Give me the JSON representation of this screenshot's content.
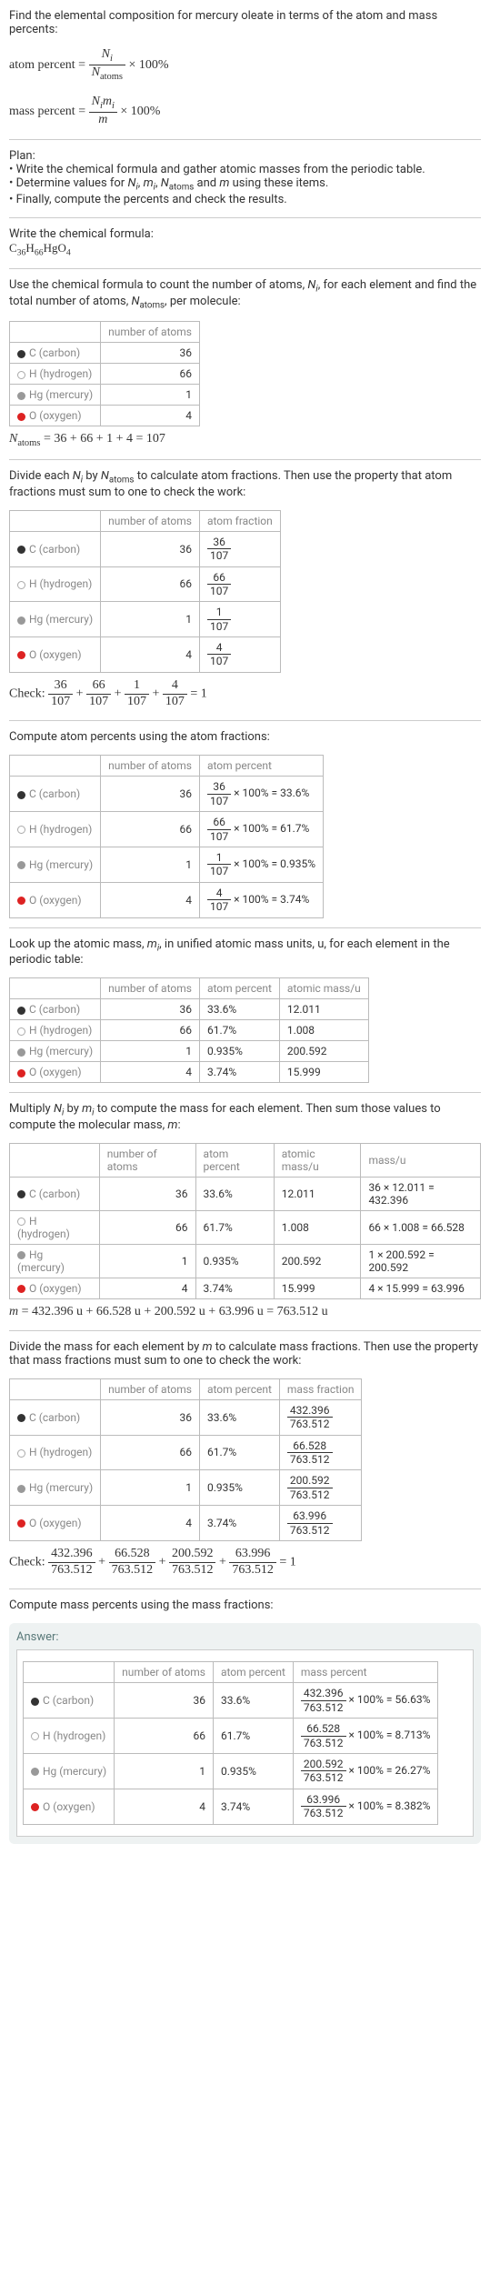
{
  "intro": "Find the elemental composition for mercury oleate in terms of the atom and mass percents:",
  "atom_percent_label": "atom percent = ",
  "atom_percent_frac_num": "N",
  "atom_percent_frac_num_sub": "i",
  "atom_percent_frac_den": "N",
  "atom_percent_frac_den_sub": "atoms",
  "times100": " × 100%",
  "mass_percent_label": "mass percent = ",
  "mass_percent_num": "N",
  "mass_percent_num_sub": "i",
  "mass_percent_num2": "m",
  "mass_percent_num2_sub": "i",
  "mass_percent_den": "m",
  "plan_title": "Plan:",
  "plan1": "• Write the chemical formula and gather atomic masses from the periodic table.",
  "plan2_a": "• Determine values for ",
  "plan2_n": "N",
  "plan2_ni": "i",
  "plan2_b": ", ",
  "plan2_m": "m",
  "plan2_mi": "i",
  "plan2_c": ", ",
  "plan2_na": "N",
  "plan2_nas": "atoms",
  "plan2_d": " and ",
  "plan2_mm": "m",
  "plan2_e": " using these items.",
  "plan3": "• Finally, compute the percents and check the results.",
  "write_formula": "Write the chemical formula:",
  "formula_c": "C",
  "formula_36": "36",
  "formula_h": "H",
  "formula_66": "66",
  "formula_hg": "Hg",
  "formula_o": "O",
  "formula_4": "4",
  "count_text_a": "Use the chemical formula to count the number of atoms, ",
  "count_text_b": ", for each element and find the total number of atoms, ",
  "count_text_c": ", per molecule:",
  "hdr_num_atoms": "number of atoms",
  "el_c": "C (carbon)",
  "el_h": "H (hydrogen)",
  "el_hg": "Hg (mercury)",
  "el_o": "O (oxygen)",
  "n_c": "36",
  "n_h": "66",
  "n_hg": "1",
  "n_o": "4",
  "natoms_eq": " = 36 + 66 + 1 + 4 = 107",
  "divide_text_a": "Divide each ",
  "divide_text_b": " by ",
  "divide_text_c": " to calculate atom fractions. Then use the property that atom fractions must sum to one to check the work:",
  "hdr_atom_frac": "atom fraction",
  "f36": "36",
  "f66": "66",
  "f1": "1",
  "f4": "4",
  "f107": "107",
  "check_label": "Check: ",
  "check_eq": " = 1",
  "compute_atom_pct": "Compute atom percents using the atom fractions:",
  "hdr_atom_pct": "atom percent",
  "ap_c": " × 100% = 33.6%",
  "ap_h": " × 100% = 61.7%",
  "ap_hg": " × 100% = 0.935%",
  "ap_o": " × 100% = 3.74%",
  "lookup_text_a": "Look up the atomic mass, ",
  "lookup_text_b": ", in unified atomic mass units, u, for each element in the periodic table:",
  "hdr_atomic_mass": "atomic mass/u",
  "pct_c": "33.6%",
  "pct_h": "61.7%",
  "pct_hg": "0.935%",
  "pct_o": "3.74%",
  "am_c": "12.011",
  "am_h": "1.008",
  "am_hg": "200.592",
  "am_o": "15.999",
  "mult_text_a": "Multiply ",
  "mult_text_b": " by ",
  "mult_text_c": " to compute the mass for each element. Then sum those values to compute the molecular mass, ",
  "mult_text_d": ":",
  "hdr_mass_u": "mass/u",
  "mc_c": "36 × 12.011 = 432.396",
  "mc_h": "66 × 1.008 = 66.528",
  "mc_hg": "1 × 200.592 = 200.592",
  "mc_o": "4 × 15.999 = 63.996",
  "m_eq": " = 432.396 u + 66.528 u + 200.592 u + 63.996 u = 763.512 u",
  "divide_mass_text_a": "Divide the mass for each element by ",
  "divide_mass_text_b": " to calculate mass fractions. Then use the property that mass fractions must sum to one to check the work:",
  "hdr_mass_frac": "mass fraction",
  "mf_c_n": "432.396",
  "mf_h_n": "66.528",
  "mf_hg_n": "200.592",
  "mf_o_n": "63.996",
  "mf_den": "763.512",
  "compute_mass_pct": "Compute mass percents using the mass fractions:",
  "answer": "Answer:",
  "hdr_mass_pct": "mass percent",
  "mp_c": " × 100% = 56.63%",
  "mp_h": " × 100% = 8.713%",
  "mp_hg": " × 100% = 26.27%",
  "mp_o": " × 100% = 8.382%"
}
